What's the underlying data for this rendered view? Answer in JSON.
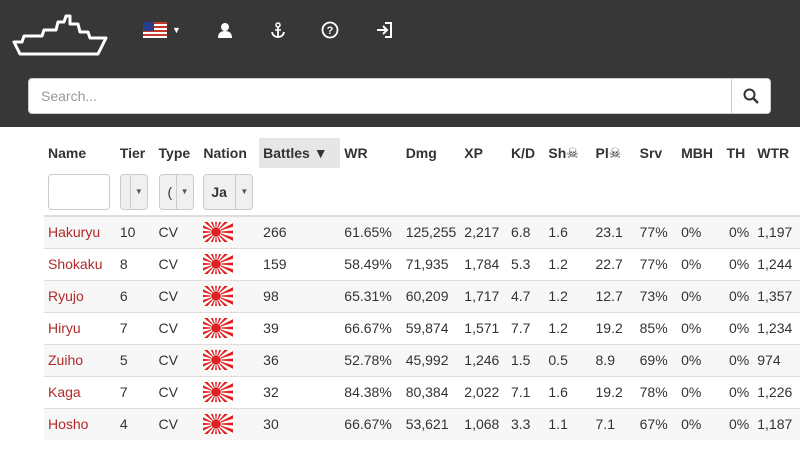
{
  "header": {
    "icons": [
      "ship-logo-icon",
      "us-flag-icon",
      "user-icon",
      "anchor-icon",
      "help-icon",
      "sign-in-icon"
    ]
  },
  "search": {
    "placeholder": "Search..."
  },
  "columns": [
    "Name",
    "Tier",
    "Type",
    "Nation",
    "Battles ▼",
    "WR",
    "Dmg",
    "XP",
    "K/D",
    "Sh☠",
    "Pl☠",
    "Srv",
    "MBH",
    "TH",
    "WTR"
  ],
  "filters": {
    "nation_value": "Ja",
    "type_value": "("
  },
  "colors": {
    "green": "#3a9a3a",
    "red": "#c73030",
    "link": "#b02a2a",
    "header_bg": "#373737"
  },
  "rows": [
    {
      "name": "Hakuryu",
      "tier": "10",
      "type": "CV",
      "battles": "266",
      "wr": "61.65%",
      "dmg": "125,255",
      "xp": "2,217",
      "kd": "6.8",
      "sh": "1.6",
      "pl": "23.1",
      "srv": "77%",
      "mbh": "0%",
      "th": "0%",
      "wtr": "1,197"
    },
    {
      "name": "Shokaku",
      "tier": "8",
      "type": "CV",
      "battles": "159",
      "wr": "58.49%",
      "dmg": "71,935",
      "xp": "1,784",
      "kd": "5.3",
      "sh": "1.2",
      "pl": "22.7",
      "srv": "77%",
      "mbh": "0%",
      "th": "0%",
      "wtr": "1,244"
    },
    {
      "name": "Ryujo",
      "tier": "6",
      "type": "CV",
      "battles": "98",
      "wr": "65.31%",
      "dmg": "60,209",
      "xp": "1,717",
      "kd": "4.7",
      "sh": "1.2",
      "pl": "12.7",
      "srv": "73%",
      "mbh": "0%",
      "th": "0%",
      "wtr": "1,357"
    },
    {
      "name": "Hiryu",
      "tier": "7",
      "type": "CV",
      "battles": "39",
      "wr": "66.67%",
      "dmg": "59,874",
      "xp": "1,571",
      "kd": "7.7",
      "sh": "1.2",
      "pl": "19.2",
      "srv": "85%",
      "mbh": "0%",
      "th": "0%",
      "wtr": "1,234"
    },
    {
      "name": "Zuiho",
      "tier": "5",
      "type": "CV",
      "battles": "36",
      "wr": "52.78%",
      "dmg": "45,992",
      "xp": "1,246",
      "kd": "1.5",
      "sh": "0.5",
      "pl": "8.9",
      "srv": "69%",
      "mbh": "0%",
      "th": "0%",
      "wtr": "974"
    },
    {
      "name": "Kaga",
      "tier": "7",
      "type": "CV",
      "battles": "32",
      "wr": "84.38%",
      "dmg": "80,384",
      "xp": "2,022",
      "kd": "7.1",
      "sh": "1.6",
      "pl": "19.2",
      "srv": "78%",
      "mbh": "0%",
      "th": "0%",
      "wtr": "1,226"
    },
    {
      "name": "Hosho",
      "tier": "4",
      "type": "CV",
      "battles": "30",
      "wr": "66.67%",
      "dmg": "53,621",
      "xp": "1,068",
      "kd": "3.3",
      "sh": "1.1",
      "pl": "7.1",
      "srv": "67%",
      "mbh": "0%",
      "th": "0%",
      "wtr": "1,187"
    }
  ]
}
